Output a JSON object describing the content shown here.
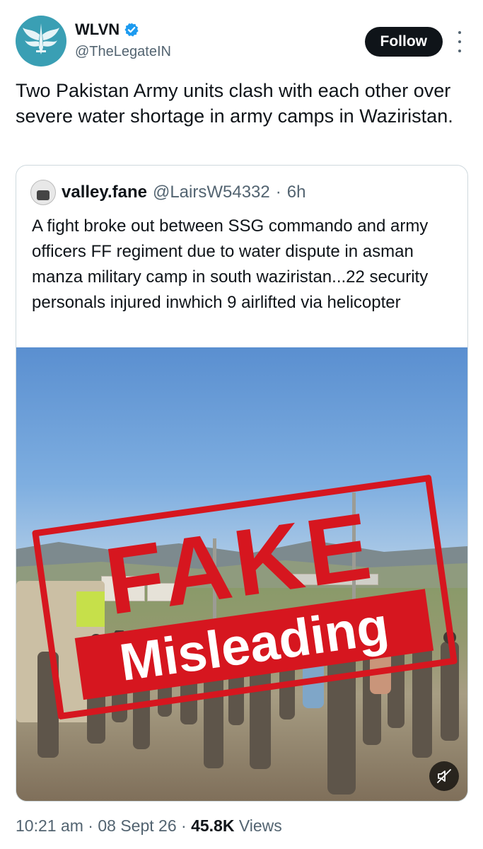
{
  "author": {
    "display_name": "WLVN",
    "handle": "@TheLegateIN",
    "avatar_icon": "winged-emblem-icon",
    "avatar_color": "#3a9fb4",
    "verified_icon": "verified-badge-icon",
    "verified_color": "#1d9bf0"
  },
  "follow_label": "Follow",
  "more_icon": "more-options-icon",
  "tweet_text": "Two Pakistan Army units clash with each other over severe water shortage in army camps in Waziristan.",
  "quote": {
    "display_name": "valley.fane",
    "handle": "@LairsW54332",
    "separator": "·",
    "time": "6h",
    "text": "A fight broke out between SSG commando and army officers FF regiment due to water dispute in asman manza military camp in south waziristan...22 security personals injured inwhich 9 airlifted via helicopter",
    "media": {
      "stamp_top": "FAKE",
      "stamp_bottom": "Misleading",
      "stamp_color": "#d6161f",
      "mute_icon": "muted-speaker-icon"
    }
  },
  "footer": {
    "time": "10:21 am",
    "sep1": "·",
    "date": "08 Sept 26",
    "sep2": "·",
    "views_count": "45.8K",
    "views_label": "Views"
  }
}
